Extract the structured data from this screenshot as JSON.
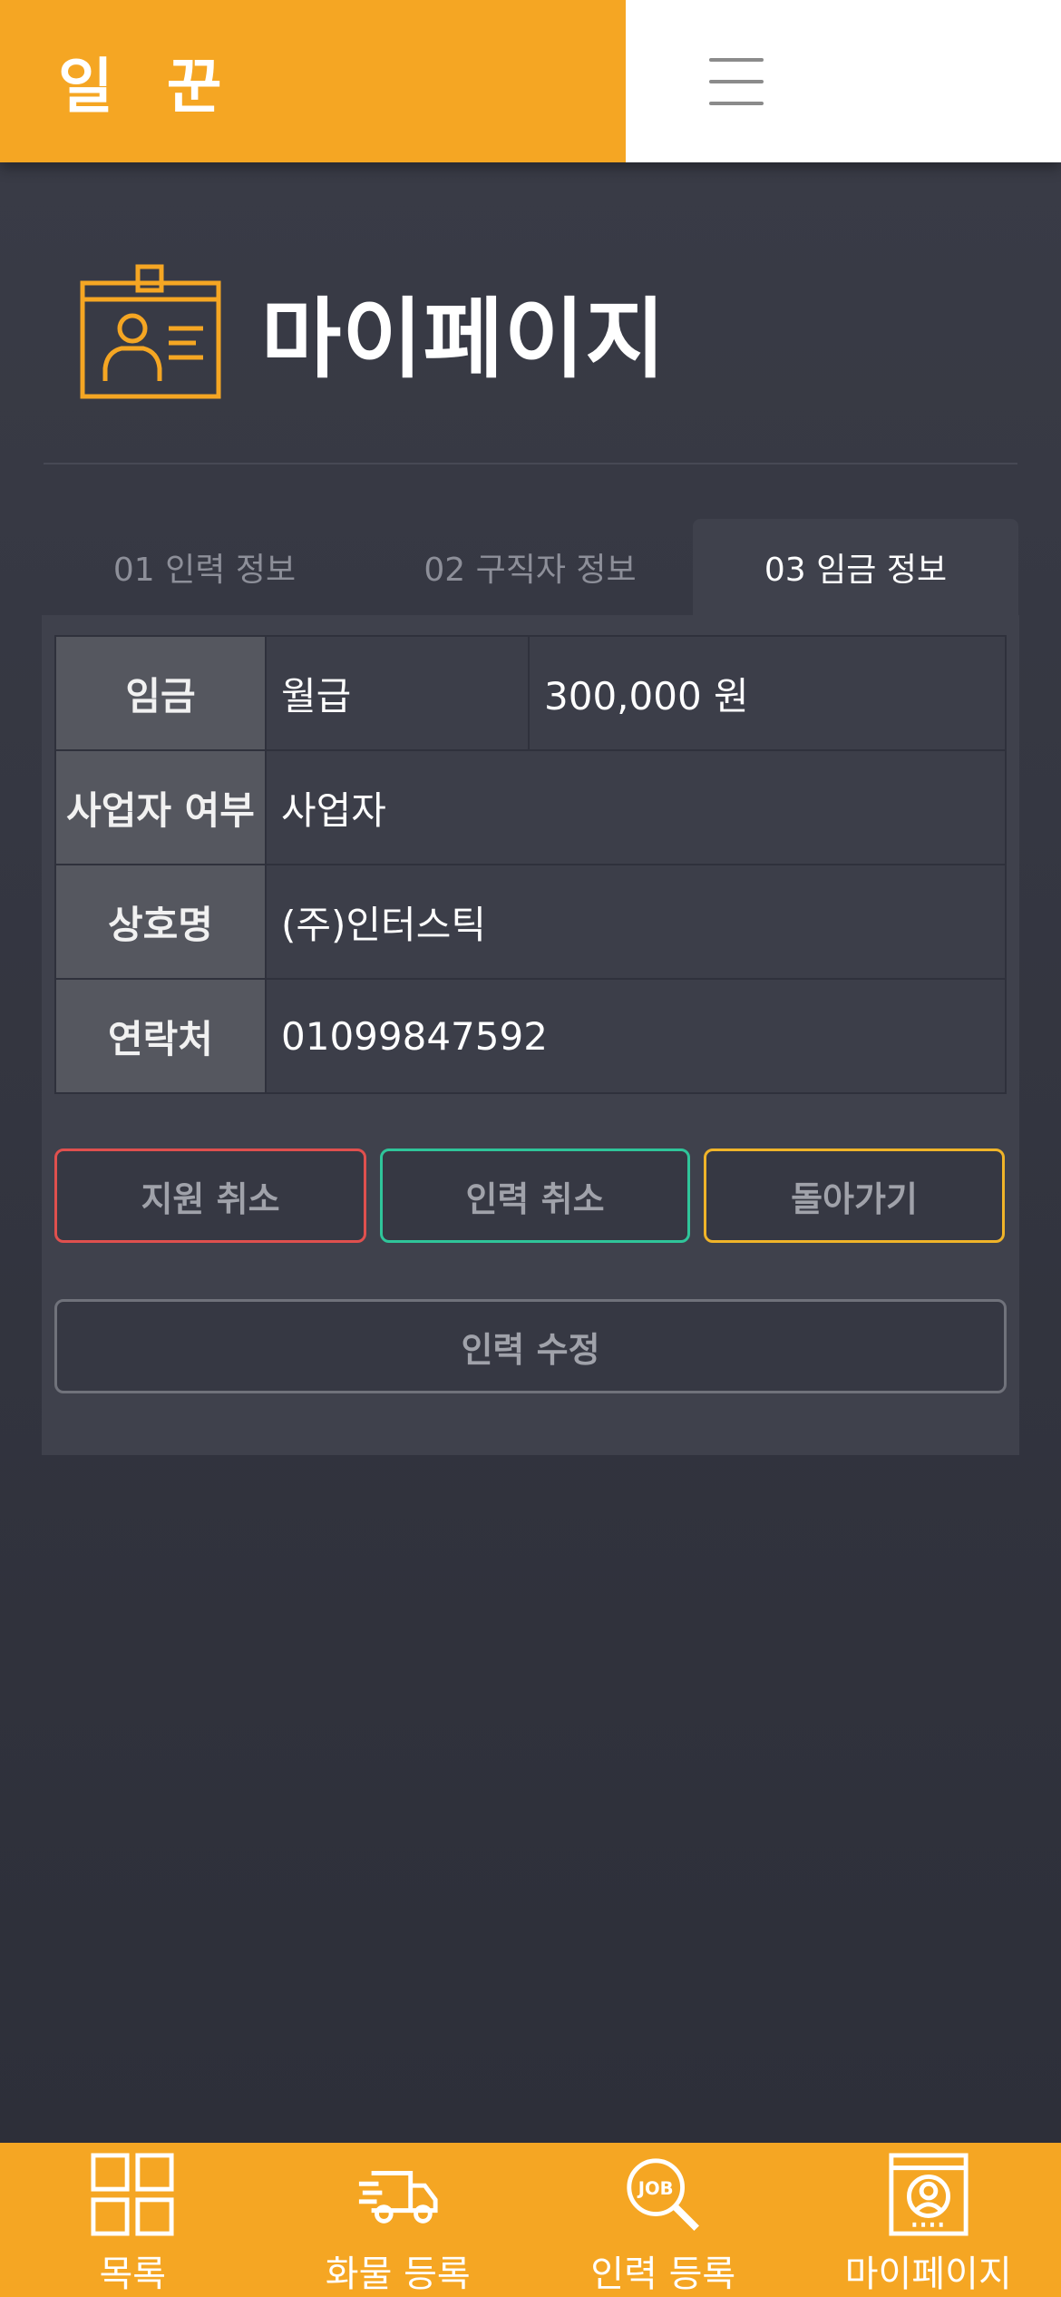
{
  "header": {
    "logo": "일 꾼",
    "menu_icon": "hamburger-menu-icon"
  },
  "page": {
    "title": "마이페이지",
    "icon": "id-badge-icon"
  },
  "tabs": [
    {
      "label": "01 인력 정보",
      "active": false
    },
    {
      "label": "02 구직자 정보",
      "active": false
    },
    {
      "label": "03 임금 정보",
      "active": true
    }
  ],
  "info": {
    "wage_label": "임금",
    "wage_type": "월급",
    "wage_amount": "300,000 원",
    "business_label": "사업자 여부",
    "business_value": "사업자",
    "company_label": "상호명",
    "company_value": "(주)인터스틱",
    "contact_label": "연락처",
    "contact_value": "01099847592"
  },
  "buttons": {
    "cancel_apply": "지원 취소",
    "cancel_labor": "인력 취소",
    "back": "돌아가기",
    "edit_labor": "인력 수정"
  },
  "nav": [
    {
      "label": "목록",
      "icon": "grid-icon"
    },
    {
      "label": "화물 등록",
      "icon": "truck-icon"
    },
    {
      "label": "인력 등록",
      "icon": "job-search-icon"
    },
    {
      "label": "마이페이지",
      "icon": "profile-frame-icon"
    }
  ],
  "colors": {
    "accent": "#f5a623",
    "background": "#2f313c",
    "cancel_apply_border": "#e0504e",
    "cancel_labor_border": "#2fc59a",
    "back_border": "#f0b429"
  }
}
